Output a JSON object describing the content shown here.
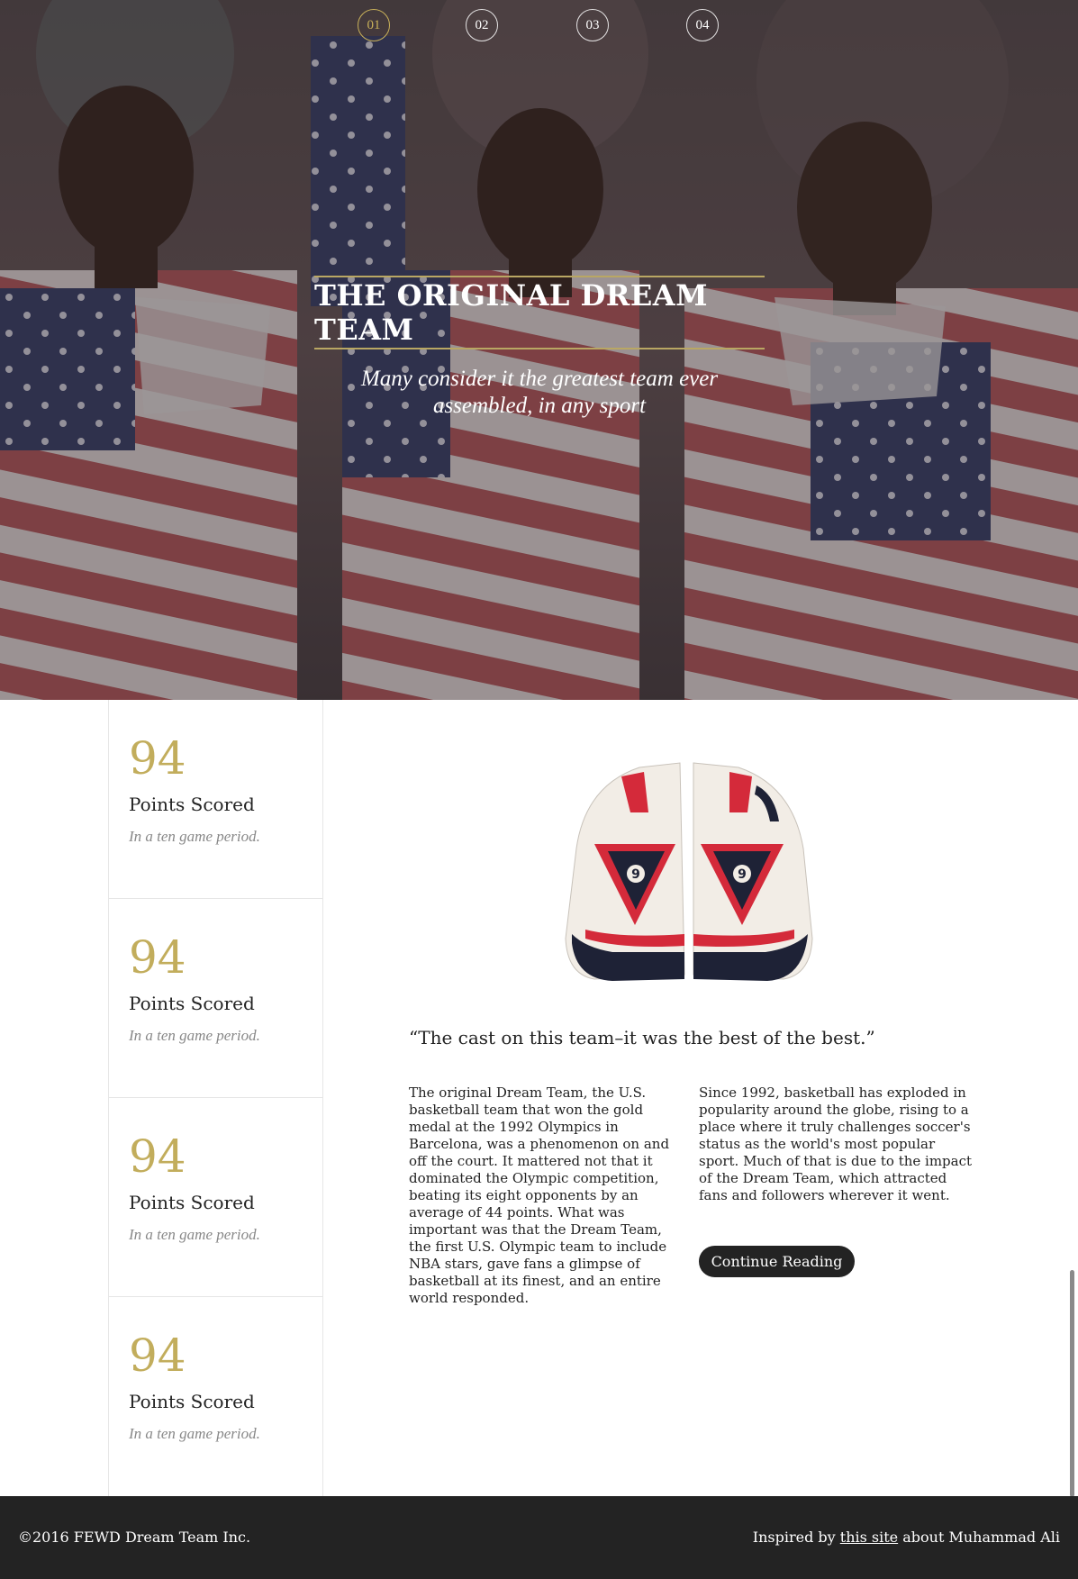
{
  "hero": {
    "nav_dots": [
      "01",
      "02",
      "03",
      "04"
    ],
    "active_dot": 0,
    "title": "THE ORIGINAL DREAM TEAM",
    "subtitle": "Many consider it the greatest team ever assembled, in any sport"
  },
  "stats": [
    {
      "number": "94",
      "label": "Points Scored",
      "note": "In a ten game period."
    },
    {
      "number": "94",
      "label": "Points Scored",
      "note": "In a ten game period."
    },
    {
      "number": "94",
      "label": "Points Scored",
      "note": "In a ten game period."
    },
    {
      "number": "94",
      "label": "Points Scored",
      "note": "In a ten game period."
    }
  ],
  "main": {
    "sneaker_number": "9",
    "quote": "“The cast on this team–it was the best of the best.”",
    "paragraph_left": "The original Dream Team, the U.S. basketball team that won the gold medal at the 1992 Olympics in Barcelona, was a phenomenon on and off the court. It mattered not that it dominated the Olympic competition, beating its eight opponents by an average of 44 points. What was important was that the Dream Team, the first U.S. Olympic team to include NBA stars, gave fans a glimpse of basketball at its finest, and an entire world responded.",
    "paragraph_right": "Since 1992, basketball has exploded in popularity around the globe, rising to a place where it truly challenges soccer's status as the world's most popular sport. Much of that is due to the impact of the Dream Team, which attracted fans and followers wherever it went.",
    "button_label": "Continue Reading"
  },
  "footer": {
    "copyright": "©2016 FEWD Dream Team Inc.",
    "inspired_prefix": "Inspired by",
    "link_text": "this site",
    "inspired_suffix": "about Muhammad Ali"
  },
  "colors": {
    "accent_gold": "#c2ad5c",
    "footer_bg": "#232323",
    "button_bg": "#232323"
  }
}
